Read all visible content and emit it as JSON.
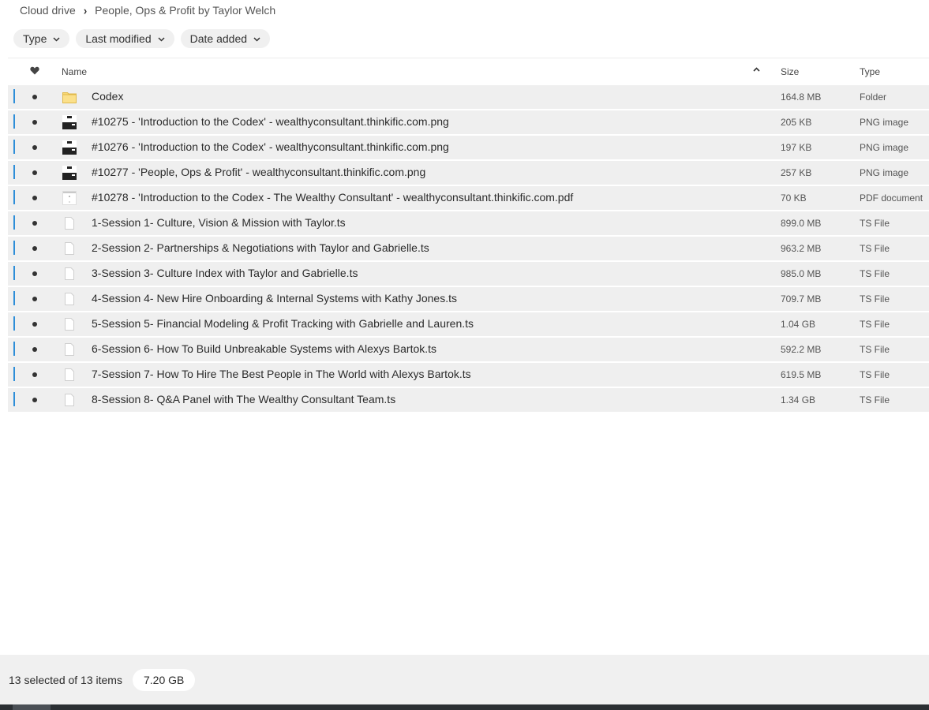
{
  "breadcrumb": {
    "root": "Cloud drive",
    "separator": "›",
    "current": "People, Ops & Profit by Taylor Welch"
  },
  "filters": [
    {
      "label": "Type"
    },
    {
      "label": "Last modified"
    },
    {
      "label": "Date added"
    }
  ],
  "table": {
    "headers": {
      "favourite_icon": "heart-icon",
      "name": "Name",
      "sort_icon": "chevron-up-icon",
      "size": "Size",
      "type": "Type"
    },
    "rows": [
      {
        "name": "Codex",
        "size": "164.8 MB",
        "type": "Folder",
        "icon": "folder-icon",
        "selected": true
      },
      {
        "name": "#10275 - 'Introduction to the Codex' - wealthyconsultant.thinkific.com.png",
        "size": "205 KB",
        "type": "PNG image",
        "icon": "image-thumbnail-icon",
        "selected": true
      },
      {
        "name": "#10276 - 'Introduction to the Codex' - wealthyconsultant.thinkific.com.png",
        "size": "197 KB",
        "type": "PNG image",
        "icon": "image-thumbnail-icon",
        "selected": true
      },
      {
        "name": "#10277 - 'People, Ops & Profit' - wealthyconsultant.thinkific.com.png",
        "size": "257 KB",
        "type": "PNG image",
        "icon": "image-thumbnail-icon",
        "selected": true
      },
      {
        "name": "#10278 - 'Introduction to the Codex - The Wealthy Consultant' - wealthyconsultant.thinkific.com.pdf",
        "size": "70 KB",
        "type": "PDF document",
        "icon": "pdf-thumbnail-icon",
        "selected": true
      },
      {
        "name": "1-Session 1- Culture, Vision & Mission with Taylor.ts",
        "size": "899.0 MB",
        "type": "TS File",
        "icon": "file-icon",
        "selected": true
      },
      {
        "name": "2-Session 2- Partnerships & Negotiations with Taylor and Gabrielle.ts",
        "size": "963.2 MB",
        "type": "TS File",
        "icon": "file-icon",
        "selected": true
      },
      {
        "name": "3-Session 3- Culture Index with Taylor and Gabrielle.ts",
        "size": "985.0 MB",
        "type": "TS File",
        "icon": "file-icon",
        "selected": true
      },
      {
        "name": "4-Session 4- New Hire Onboarding & Internal Systems with Kathy Jones.ts",
        "size": "709.7 MB",
        "type": "TS File",
        "icon": "file-icon",
        "selected": true
      },
      {
        "name": "5-Session 5- Financial Modeling & Profit Tracking with Gabrielle and Lauren.ts",
        "size": "1.04 GB",
        "type": "TS File",
        "icon": "file-icon",
        "selected": true
      },
      {
        "name": "6-Session 6- How To Build Unbreakable Systems with Alexys Bartok.ts",
        "size": "592.2 MB",
        "type": "TS File",
        "icon": "file-icon",
        "selected": true
      },
      {
        "name": "7-Session 7- How To Hire The Best People in The World with Alexys Bartok.ts",
        "size": "619.5 MB",
        "type": "TS File",
        "icon": "file-icon",
        "selected": true
      },
      {
        "name": "8-Session 8- Q&A Panel with The Wealthy Consultant Team.ts",
        "size": "1.34 GB",
        "type": "TS File",
        "icon": "file-icon",
        "selected": true
      }
    ]
  },
  "footer": {
    "selection": "13 selected of 13 items",
    "total_size": "7.20 GB"
  },
  "colors": {
    "selection_bar": "#2e8ed8",
    "folder": "#f7d774",
    "row_background": "#efefef"
  }
}
